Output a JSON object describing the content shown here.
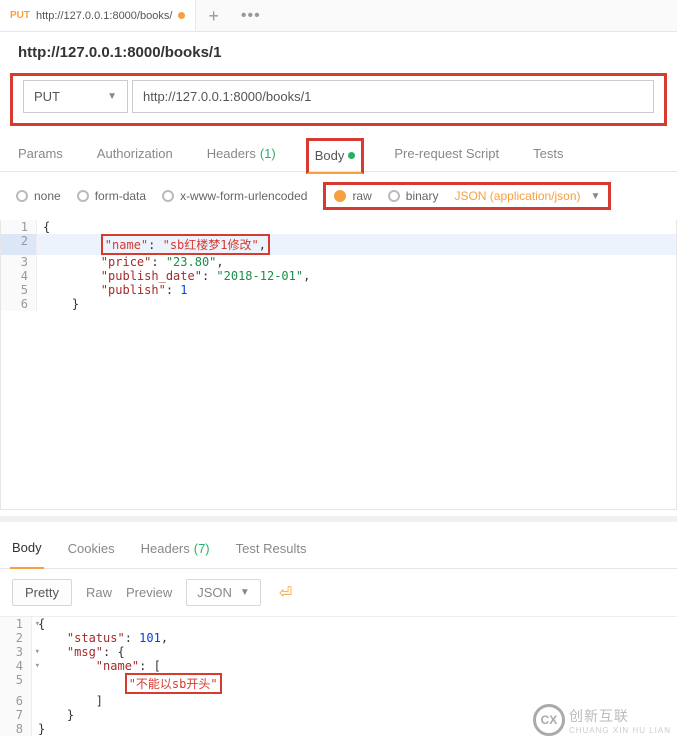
{
  "tab": {
    "method": "PUT",
    "title": "http://127.0.0.1:8000/books/",
    "add": "+",
    "more": "•••"
  },
  "title": "http://127.0.0.1:8000/books/1",
  "request": {
    "method": "PUT",
    "url": "http://127.0.0.1:8000/books/1"
  },
  "req_tabs": {
    "params": "Params",
    "auth": "Authorization",
    "headers": "Headers",
    "headers_count": "(1)",
    "body": "Body",
    "prereq": "Pre-request Script",
    "tests": "Tests"
  },
  "body_opts": {
    "none": "none",
    "formdata": "form-data",
    "xwww": "x-www-form-urlencoded",
    "raw": "raw",
    "binary": "binary",
    "json_sel": "JSON (application/json)"
  },
  "req_body": {
    "l1": "{",
    "l2_key": "\"name\"",
    "l2_val": "\"sb红楼梦1修改\"",
    "l3_key": "\"price\"",
    "l3_val": "\"23.80\"",
    "l4_key": "\"publish_date\"",
    "l4_val": "\"2018-12-01\"",
    "l5_key": "\"publish\"",
    "l5_val": "1",
    "l6": "}"
  },
  "resp_tabs": {
    "body": "Body",
    "cookies": "Cookies",
    "headers": "Headers",
    "headers_count": "(7)",
    "tests": "Test Results"
  },
  "resp_toolbar": {
    "pretty": "Pretty",
    "raw": "Raw",
    "preview": "Preview",
    "fmt": "JSON"
  },
  "resp_body": {
    "l1": "{",
    "l2_key": "\"status\"",
    "l2_val": "101",
    "l3_key": "\"msg\"",
    "l4_key": "\"name\"",
    "l5_val": "\"不能以sb开头\"",
    "l6": "]",
    "l7": "}",
    "l8": "}"
  },
  "logo": {
    "c": "CX",
    "name": "创新互联",
    "sub": "CHUANG XIN HU LIAN"
  }
}
